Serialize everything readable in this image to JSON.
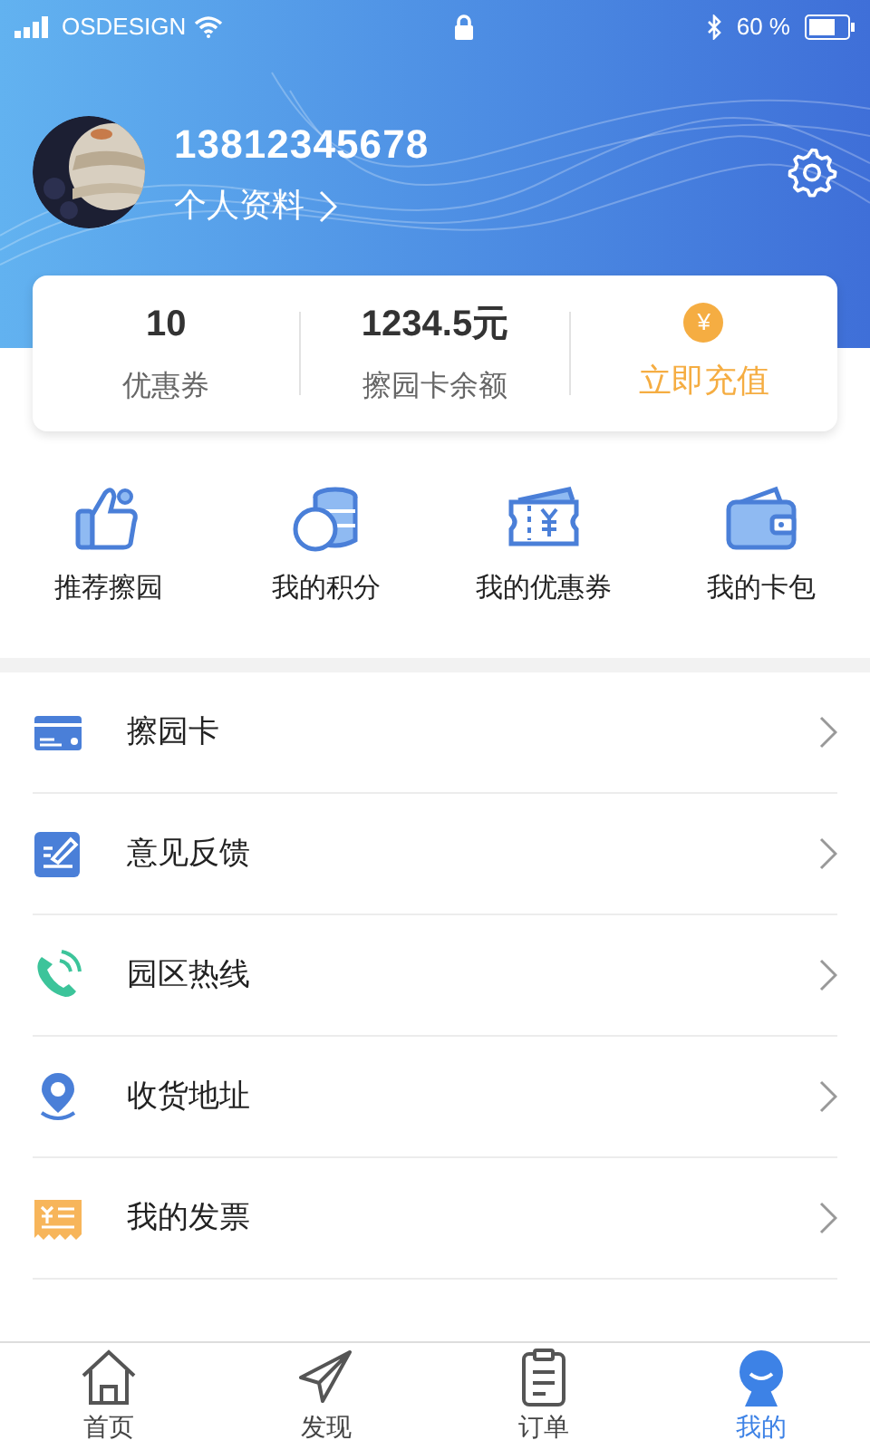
{
  "status_bar": {
    "carrier": "OSDESIGN",
    "battery": "60 %"
  },
  "profile": {
    "phone": "13812345678",
    "link": "个人资料"
  },
  "stats": [
    {
      "value": "10",
      "label": "优惠券"
    },
    {
      "value": "1234.5元",
      "label": "擦园卡余额"
    }
  ],
  "recharge": {
    "symbol": "¥",
    "label": "立即充值"
  },
  "shortcuts": [
    {
      "label": "推荐擦园"
    },
    {
      "label": "我的积分"
    },
    {
      "label": "我的优惠券"
    },
    {
      "label": "我的卡包"
    }
  ],
  "menu": [
    {
      "label": "擦园卡"
    },
    {
      "label": "意见反馈"
    },
    {
      "label": "园区热线"
    },
    {
      "label": "收货地址"
    },
    {
      "label": "我的发票"
    }
  ],
  "tabs": [
    {
      "label": "首页",
      "selected": false
    },
    {
      "label": "发现",
      "selected": false
    },
    {
      "label": "订单",
      "selected": false
    },
    {
      "label": "我的",
      "selected": true
    }
  ]
}
